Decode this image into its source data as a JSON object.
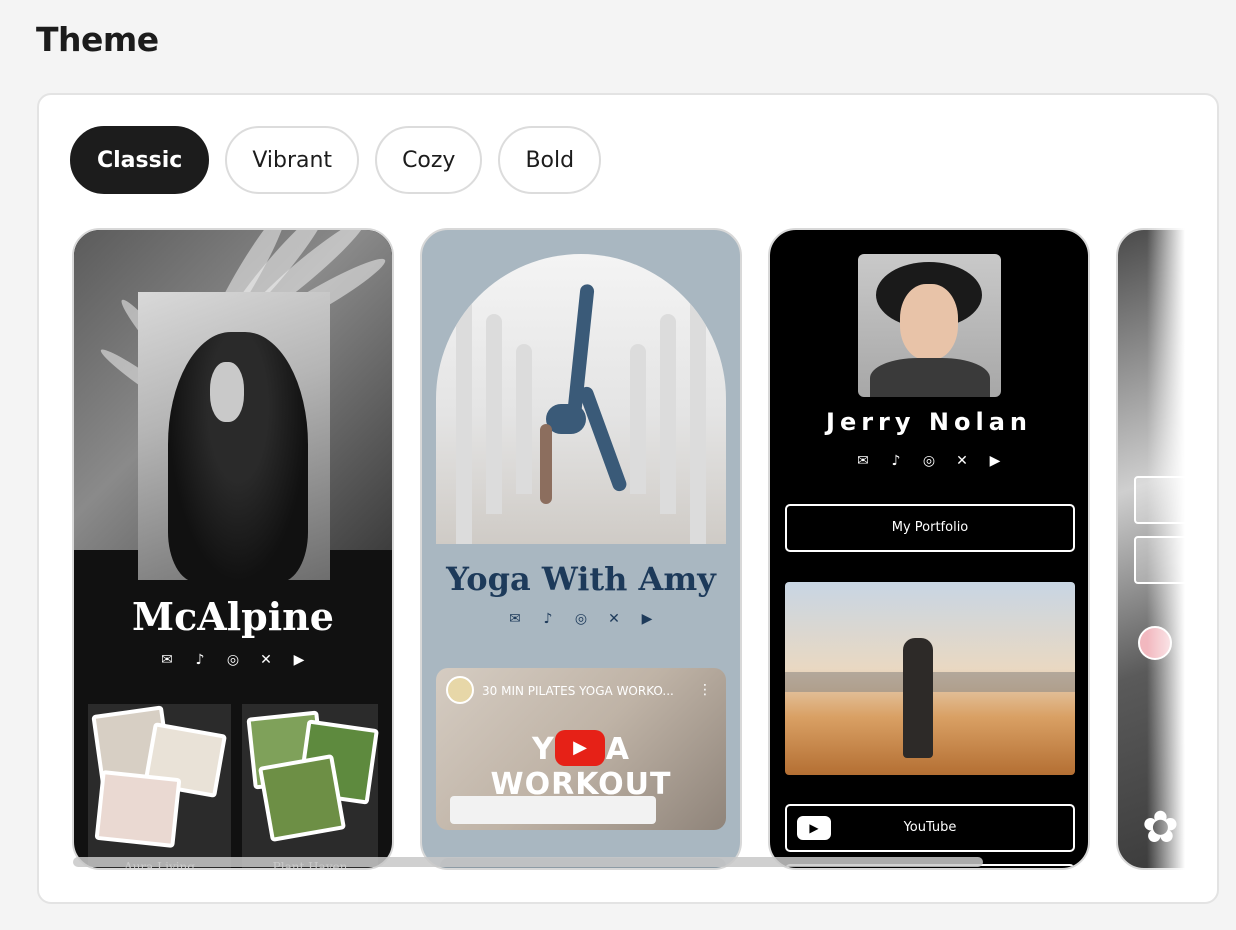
{
  "page": {
    "title": "Theme"
  },
  "tabs": [
    {
      "label": "Classic",
      "active": true
    },
    {
      "label": "Vibrant",
      "active": false
    },
    {
      "label": "Cozy",
      "active": false
    },
    {
      "label": "Bold",
      "active": false
    }
  ],
  "cards": {
    "classic": {
      "name": "McAlpine",
      "socials": [
        "mail-icon",
        "tiktok-icon",
        "instagram-icon",
        "x-icon",
        "youtube-icon"
      ],
      "tiles": [
        {
          "label": "Aura Living"
        },
        {
          "label": "Plant Haven"
        }
      ]
    },
    "yoga": {
      "name": "Yoga With Amy",
      "socials": [
        "mail-icon",
        "tiktok-icon",
        "instagram-icon",
        "x-icon",
        "youtube-icon"
      ],
      "video": {
        "title": "30 MIN PILATES YOGA WORKO...",
        "overlay": "YOGA WORKOUT",
        "play_color": "#e62117"
      }
    },
    "jerry": {
      "name": "Jerry Nolan",
      "socials": [
        "mail-icon",
        "tiktok-icon",
        "instagram-icon",
        "x-icon",
        "youtube-icon"
      ],
      "buttons": [
        {
          "label": "My Portfolio"
        },
        {
          "label": "YouTube"
        }
      ]
    }
  },
  "colors": {
    "active_tab_bg": "#1c1c1c",
    "yoga_bg": "#a9b7c1",
    "yoga_text": "#1d3a5a"
  }
}
